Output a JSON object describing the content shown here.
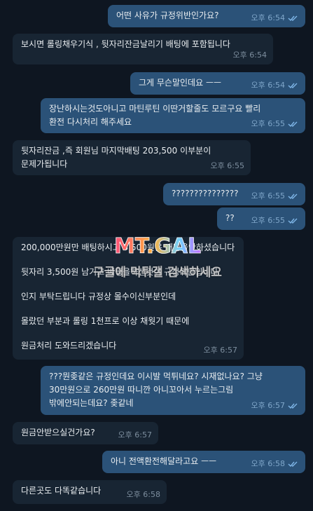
{
  "messages": [
    {
      "direction": "out",
      "text": "어떤 사유가 규정위반인가요?",
      "time": "오후 6:54",
      "read": true
    },
    {
      "direction": "in",
      "text": "보시면 롤링채우기식 , 뒷자리잔금날리기 배팅에 포함됩니다",
      "time": "오후 6:54"
    },
    {
      "direction": "out",
      "text": "그게 무슨말인데요 ㅡㅡ",
      "time": "오후 6:54",
      "read": true
    },
    {
      "direction": "out",
      "text": "장난하시는것도아니고 마틴루틴 이딴거할줄도 모르구요 빨리\n환전 다시처리 해주세요",
      "time": "오후 6:55",
      "read": true
    },
    {
      "direction": "in",
      "text": "뒷자리잔금 ,즉 회원님 마지막배팅 203,500 이부분이\n문제가됩니다",
      "time": "오후 6:55"
    },
    {
      "direction": "out",
      "text": "???????????????",
      "time": "오후 6:55",
      "read": true
    },
    {
      "direction": "out",
      "text": "??",
      "time": "오후 6:55",
      "read": true
    },
    {
      "direction": "in",
      "text": "200,000만원만 배팅하시고 3,500원은 배팅을안하셨습니다\n\n뒷자리 3,500원 남기고 배팅을하신것이 규정위반입니다\n\n인지 부탁드립니다 규정상 몰수이신부분인데\n\n몰랐던 부분과 롤링 1천프로 이상 채웟기 때문에\n\n원금처리 도와드리겠습니다",
      "time": "오후 6:57"
    },
    {
      "direction": "out",
      "text": "???뭔좆같은 규정인데요 이시발 먹튀네요? 시재없나요? 그냥\n30만원으로 260만원 따니깐 아니꼬아서 누르는그림\n밖에안되는데요? 좆같네",
      "time": "오후 6:57",
      "read": true
    },
    {
      "direction": "in",
      "text": "원금안받으실건가요?",
      "time": "오후 6:57"
    },
    {
      "direction": "out",
      "text": "아니 전액환전해달라고요 ㅡㅡ",
      "time": "오후 6:58",
      "read": true
    },
    {
      "direction": "in",
      "text": "다른곳도 다똑같습니다",
      "time": "오후 6:58"
    }
  ],
  "watermark": {
    "logo_text": "MT.GAL",
    "caption": "구글에 먹튀갤 검색하세요"
  },
  "colors": {
    "background": "#0e1621",
    "outgoing_bubble": "#2b5278",
    "incoming_bubble": "#182533",
    "read_ticks": "#7fb6e8"
  }
}
